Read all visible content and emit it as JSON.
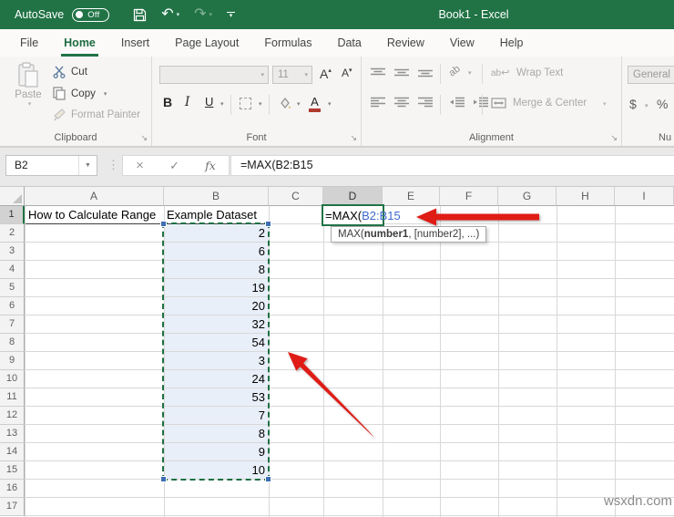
{
  "titlebar": {
    "autosave_label": "AutoSave",
    "autosave_state": "Off",
    "title": "Book1 - Excel"
  },
  "tabs": [
    {
      "label": "File"
    },
    {
      "label": "Home"
    },
    {
      "label": "Insert"
    },
    {
      "label": "Page Layout"
    },
    {
      "label": "Formulas"
    },
    {
      "label": "Data"
    },
    {
      "label": "Review"
    },
    {
      "label": "View"
    },
    {
      "label": "Help"
    }
  ],
  "active_tab": "Home",
  "ribbon": {
    "clipboard": {
      "group_label": "Clipboard",
      "paste_label": "Paste",
      "cut_label": "Cut",
      "copy_label": "Copy",
      "format_painter_label": "Format Painter"
    },
    "font": {
      "group_label": "Font",
      "font_size": "11",
      "bold": "B",
      "italic": "I",
      "underline": "U",
      "grow": "A",
      "shrink": "A",
      "color_letter": "A"
    },
    "alignment": {
      "group_label": "Alignment",
      "wrap_text_label": "Wrap Text",
      "merge_center_label": "Merge & Center"
    },
    "number": {
      "group_label": "Nu",
      "format": "General",
      "currency": "$",
      "percent": "%"
    }
  },
  "formula_bar": {
    "name_box": "B2",
    "fx_label": "fx",
    "formula": "=MAX(B2:B15"
  },
  "grid": {
    "columns": [
      "A",
      "B",
      "C",
      "D",
      "E",
      "F",
      "G",
      "H",
      "I"
    ],
    "active_column": "D",
    "rows": [
      "1",
      "2",
      "3",
      "4",
      "5",
      "6",
      "7",
      "8",
      "9",
      "10",
      "11",
      "12",
      "13",
      "14",
      "15",
      "16",
      "17"
    ],
    "active_row": "1",
    "cells": {
      "A1": "How to Calculate Range",
      "B1": "Example Dataset"
    },
    "b_values": [
      "2",
      "6",
      "8",
      "19",
      "20",
      "32",
      "54",
      "3",
      "24",
      "53",
      "7",
      "8",
      "9",
      "10"
    ],
    "selected_range": "B2:B15",
    "d1": {
      "prefix": "=MAX(",
      "reference": "B2:B15"
    },
    "tooltip": {
      "pre": "MAX(",
      "bold": "number1",
      "post": ", [number2], ...)"
    }
  },
  "watermark": "wsxdn.com",
  "colors": {
    "excel_green": "#217346",
    "arrow_red": "#DF1B12",
    "reference_blue": "#3E68C9",
    "selection_fill": "#E9EFF8"
  }
}
